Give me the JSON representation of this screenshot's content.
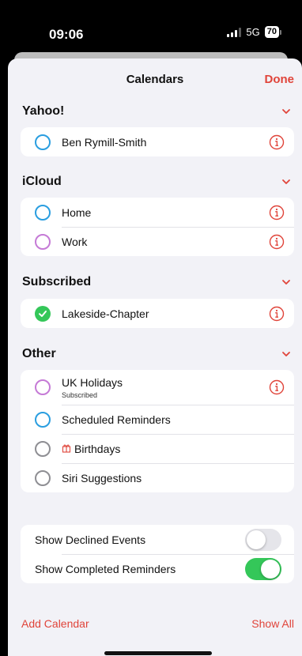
{
  "status": {
    "time": "09:06",
    "network": "5G",
    "battery": "70"
  },
  "nav": {
    "title": "Calendars",
    "done_label": "Done"
  },
  "sections": [
    {
      "title": "Yahoo!",
      "rows": [
        {
          "label": "Ben Rymill-Smith",
          "color": "#2a9ee0"
        }
      ]
    },
    {
      "title": "iCloud",
      "rows": [
        {
          "label": "Home",
          "color": "#2a9ee0"
        },
        {
          "label": "Work",
          "color": "#c57ad6"
        }
      ]
    },
    {
      "title": "Subscribed",
      "rows": [
        {
          "label": "Lakeside-Chapter",
          "color": "#34c759",
          "checked": true
        }
      ]
    },
    {
      "title": "Other",
      "rows": [
        {
          "label": "UK Holidays",
          "sublabel": "Subscribed",
          "color": "#c57ad6"
        },
        {
          "label": "Scheduled Reminders",
          "color": "#2a9ee0"
        },
        {
          "label": "Birthdays",
          "color": "#8e8e93",
          "icon": "gift-icon"
        },
        {
          "label": "Siri Suggestions",
          "color": "#8e8e93"
        }
      ]
    }
  ],
  "settings": [
    {
      "label": "Show Declined Events",
      "on": false
    },
    {
      "label": "Show Completed Reminders",
      "on": true
    }
  ],
  "footer": {
    "add_calendar": "Add Calendar",
    "show_all": "Show All"
  },
  "colors": {
    "accent": "#e0443a",
    "toggle_on": "#34c759"
  },
  "icons": {
    "info": "info-icon",
    "chevron": "chevron-down-icon",
    "check": "checkmark-icon"
  }
}
